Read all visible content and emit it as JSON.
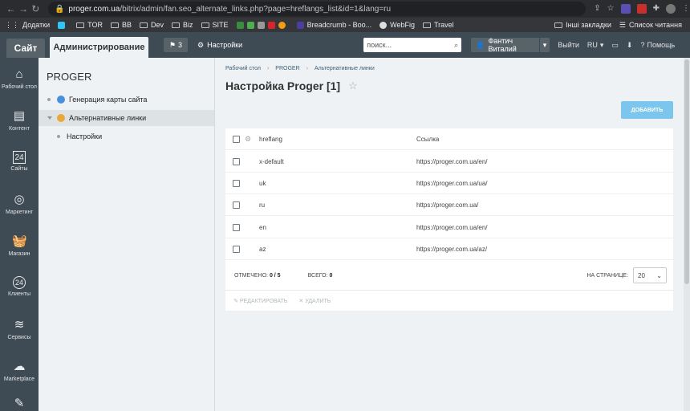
{
  "browser": {
    "url_host": "proger.com.ua",
    "url_path": "/bitrix/admin/fan.seo_alternate_links.php?page=hreflangs_list&id=1&lang=ru",
    "bookmarks": [
      "Додатки",
      "TOR",
      "BB",
      "Dev",
      "Biz",
      "SITE",
      "Breadcrumb - Boo...",
      "WebFig",
      "Travel"
    ],
    "bookmarks_right": [
      "Інші закладки",
      "Список читання"
    ]
  },
  "header": {
    "site_tab": "Сайт",
    "admin_tab": "Администрирование",
    "notifications": "3",
    "settings": "Настройки",
    "search_placeholder": "поиск...",
    "user": "Фантич Виталий",
    "logout": "Выйти",
    "lang": "RU",
    "help": "Помощь"
  },
  "leftmenu": [
    {
      "label": "Рабочий стол",
      "icon": "home-icon"
    },
    {
      "label": "Контент",
      "icon": "document-icon"
    },
    {
      "label": "Сайты",
      "icon": "calendar-icon"
    },
    {
      "label": "Маркетинг",
      "icon": "target-icon"
    },
    {
      "label": "Магазин",
      "icon": "basket-icon"
    },
    {
      "label": "Клиенты",
      "icon": "clients-icon"
    },
    {
      "label": "Сервисы",
      "icon": "layers-icon"
    },
    {
      "label": "Marketplace",
      "icon": "cloud-download-icon"
    }
  ],
  "tree": {
    "title": "PROGER",
    "items": [
      {
        "label": "Генерация карты сайта"
      },
      {
        "label": "Альтернативные линки"
      },
      {
        "label": "Настройки"
      }
    ]
  },
  "main": {
    "breadcrumb": [
      "Рабочий стол",
      "PROGER",
      "Альтернативные линки"
    ],
    "title": "Настройка Proger [1]",
    "add_button": "ДОБАВИТЬ",
    "columns": [
      "hreflang",
      "Ссылка"
    ],
    "rows": [
      {
        "hreflang": "x-default",
        "link": "https://proger.com.ua/en/"
      },
      {
        "hreflang": "uk",
        "link": "https://proger.com.ua/ua/"
      },
      {
        "hreflang": "ru",
        "link": "https://proger.com.ua/"
      },
      {
        "hreflang": "en",
        "link": "https://proger.com.ua/en/"
      },
      {
        "hreflang": "az",
        "link": "https://proger.com.ua/az/"
      }
    ],
    "marked_label": "ОТМЕЧЕНО:",
    "marked_value": "0 / 5",
    "total_label": "ВСЕГО:",
    "total_value": "0",
    "per_page_label": "НА СТРАНИЦЕ:",
    "per_page_value": "20",
    "edit_action": "РЕДАКТИРОВАТЬ",
    "delete_action": "УДАЛИТЬ"
  }
}
